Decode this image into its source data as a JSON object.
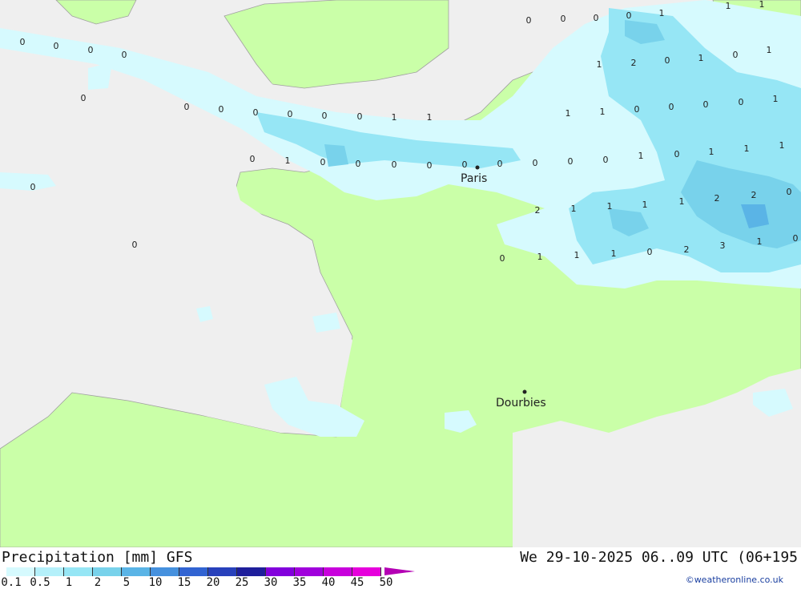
{
  "header": {
    "title": "Precipitation [mm] GFS",
    "datetime": "We 29-10-2025 06..09 UTC (06+195"
  },
  "legend": {
    "labels": [
      "0.1",
      "0.5",
      "1",
      "2",
      "5",
      "10",
      "15",
      "20",
      "25",
      "30",
      "35",
      "40",
      "45",
      "50"
    ],
    "colors": [
      "#d6fafe",
      "#b4f0fa",
      "#96e6f5",
      "#78d2eb",
      "#5ab4e6",
      "#4691de",
      "#3264d2",
      "#2841bb",
      "#1e1e9b",
      "#8200dc",
      "#a000dc",
      "#c800dc",
      "#e600dc",
      "#b400b4"
    ]
  },
  "colors": {
    "land": "#caffa8",
    "sea": "#efefef",
    "light_rain": "#d6fafe",
    "moderate_rain": "#96e6f5",
    "heavy_rain": "#78d2eb",
    "heavier_rain": "#5ab4e6"
  },
  "cities": [
    {
      "name": "Paris"
    },
    {
      "name": "Dourbies"
    }
  ],
  "grid_values": [
    "0",
    "0",
    "0",
    "0",
    "0",
    "0",
    "0",
    "0",
    "0",
    "0",
    "0",
    "0",
    "0",
    "1",
    "1",
    "0",
    "1",
    "0",
    "0",
    "0",
    "0",
    "0",
    "0",
    "0",
    "0",
    "0",
    "0",
    "0",
    "0",
    "0",
    "1",
    "1",
    "1",
    "1",
    "2",
    "0",
    "1",
    "0",
    "1",
    "1",
    "1",
    "0",
    "0",
    "0",
    "0",
    "1",
    "1",
    "0",
    "1",
    "1",
    "1",
    "2",
    "1",
    "1",
    "1",
    "1",
    "2",
    "2",
    "0",
    "0",
    "1",
    "1",
    "1",
    "0",
    "2",
    "3",
    "1",
    "0"
  ],
  "credit": "©weatheronline.co.uk"
}
